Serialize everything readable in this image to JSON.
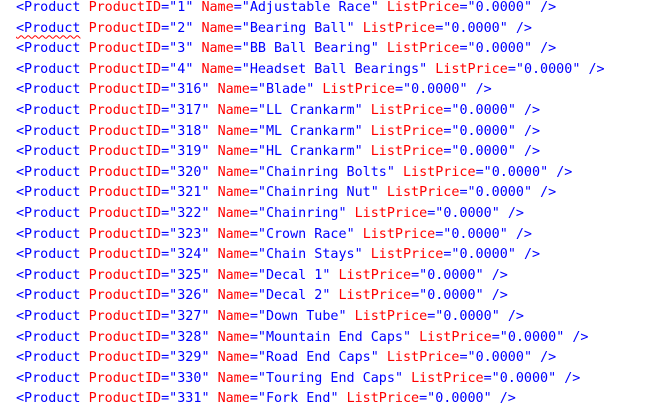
{
  "editor": {
    "rows": [
      {
        "tag": "<Product",
        "id_attr": "ProductID",
        "id": "1",
        "name_attr": "Name",
        "name": "Adjustable Race",
        "price_attr": "ListPrice",
        "price": "0.0000",
        "close": "/>",
        "squiggle": false
      },
      {
        "tag": "<Product",
        "id_attr": "ProductID",
        "id": "2",
        "name_attr": "Name",
        "name": "Bearing Ball",
        "price_attr": "ListPrice",
        "price": "0.0000",
        "close": "/>",
        "squiggle": true
      },
      {
        "tag": "<Product",
        "id_attr": "ProductID",
        "id": "3",
        "name_attr": "Name",
        "name": "BB Ball Bearing",
        "price_attr": "ListPrice",
        "price": "0.0000",
        "close": "/>",
        "squiggle": false
      },
      {
        "tag": "<Product",
        "id_attr": "ProductID",
        "id": "4",
        "name_attr": "Name",
        "name": "Headset Ball Bearings",
        "price_attr": "ListPrice",
        "price": "0.0000",
        "close": "/>",
        "squiggle": false
      },
      {
        "tag": "<Product",
        "id_attr": "ProductID",
        "id": "316",
        "name_attr": "Name",
        "name": "Blade",
        "price_attr": "ListPrice",
        "price": "0.0000",
        "close": "/>",
        "squiggle": false
      },
      {
        "tag": "<Product",
        "id_attr": "ProductID",
        "id": "317",
        "name_attr": "Name",
        "name": "LL Crankarm",
        "price_attr": "ListPrice",
        "price": "0.0000",
        "close": "/>",
        "squiggle": false
      },
      {
        "tag": "<Product",
        "id_attr": "ProductID",
        "id": "318",
        "name_attr": "Name",
        "name": "ML Crankarm",
        "price_attr": "ListPrice",
        "price": "0.0000",
        "close": "/>",
        "squiggle": false
      },
      {
        "tag": "<Product",
        "id_attr": "ProductID",
        "id": "319",
        "name_attr": "Name",
        "name": "HL Crankarm",
        "price_attr": "ListPrice",
        "price": "0.0000",
        "close": "/>",
        "squiggle": false
      },
      {
        "tag": "<Product",
        "id_attr": "ProductID",
        "id": "320",
        "name_attr": "Name",
        "name": "Chainring Bolts",
        "price_attr": "ListPrice",
        "price": "0.0000",
        "close": "/>",
        "squiggle": false
      },
      {
        "tag": "<Product",
        "id_attr": "ProductID",
        "id": "321",
        "name_attr": "Name",
        "name": "Chainring Nut",
        "price_attr": "ListPrice",
        "price": "0.0000",
        "close": "/>",
        "squiggle": false
      },
      {
        "tag": "<Product",
        "id_attr": "ProductID",
        "id": "322",
        "name_attr": "Name",
        "name": "Chainring",
        "price_attr": "ListPrice",
        "price": "0.0000",
        "close": "/>",
        "squiggle": false
      },
      {
        "tag": "<Product",
        "id_attr": "ProductID",
        "id": "323",
        "name_attr": "Name",
        "name": "Crown Race",
        "price_attr": "ListPrice",
        "price": "0.0000",
        "close": "/>",
        "squiggle": false
      },
      {
        "tag": "<Product",
        "id_attr": "ProductID",
        "id": "324",
        "name_attr": "Name",
        "name": "Chain Stays",
        "price_attr": "ListPrice",
        "price": "0.0000",
        "close": "/>",
        "squiggle": false
      },
      {
        "tag": "<Product",
        "id_attr": "ProductID",
        "id": "325",
        "name_attr": "Name",
        "name": "Decal 1",
        "price_attr": "ListPrice",
        "price": "0.0000",
        "close": "/>",
        "squiggle": false
      },
      {
        "tag": "<Product",
        "id_attr": "ProductID",
        "id": "326",
        "name_attr": "Name",
        "name": "Decal 2",
        "price_attr": "ListPrice",
        "price": "0.0000",
        "close": "/>",
        "squiggle": false
      },
      {
        "tag": "<Product",
        "id_attr": "ProductID",
        "id": "327",
        "name_attr": "Name",
        "name": "Down Tube",
        "price_attr": "ListPrice",
        "price": "0.0000",
        "close": "/>",
        "squiggle": false
      },
      {
        "tag": "<Product",
        "id_attr": "ProductID",
        "id": "328",
        "name_attr": "Name",
        "name": "Mountain End Caps",
        "price_attr": "ListPrice",
        "price": "0.0000",
        "close": "/>",
        "squiggle": false
      },
      {
        "tag": "<Product",
        "id_attr": "ProductID",
        "id": "329",
        "name_attr": "Name",
        "name": "Road End Caps",
        "price_attr": "ListPrice",
        "price": "0.0000",
        "close": "/>",
        "squiggle": false
      },
      {
        "tag": "<Product",
        "id_attr": "ProductID",
        "id": "330",
        "name_attr": "Name",
        "name": "Touring End Caps",
        "price_attr": "ListPrice",
        "price": "0.0000",
        "close": "/>",
        "squiggle": false
      },
      {
        "tag": "<Product",
        "id_attr": "ProductID",
        "id": "331",
        "name_attr": "Name",
        "name": "Fork End",
        "price_attr": "ListPrice",
        "price": "0.0000",
        "close": "/>",
        "squiggle": false
      }
    ]
  },
  "colors": {
    "tag": "#0000ff",
    "attribute": "#ff0000",
    "value": "#0000ff",
    "squiggle": "#ff0000"
  }
}
